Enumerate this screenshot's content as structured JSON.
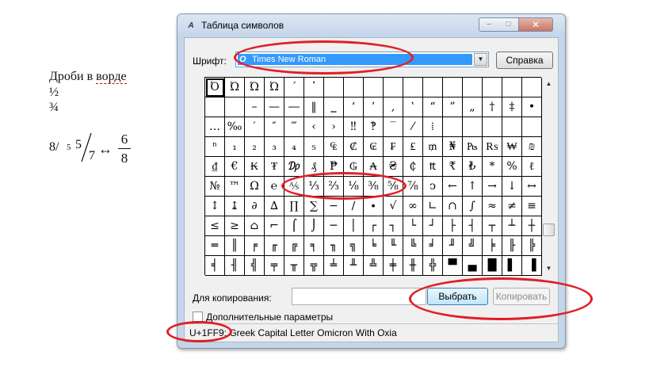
{
  "document": {
    "title": "Дроби в ворде",
    "title_part1": "Дроби в ",
    "title_part2": "ворде",
    "line_half": "½",
    "line_three_quarters": "¾",
    "formula": {
      "slash_fraction": "8/5",
      "slash_num": "8/",
      "slash_den": "5",
      "diagonal_num": "5",
      "diagonal_den": "7",
      "arrow": "↔",
      "stacked_num": "6",
      "stacked_den": "8"
    }
  },
  "dialog": {
    "title": "Таблица символов",
    "app_icon_glyph": "A",
    "min_glyph": "–",
    "max_glyph": "□",
    "close_glyph": "✕",
    "font_label": "Шрифт:",
    "font_value": "Times New Roman",
    "font_icon_glyph": "O",
    "font_dropdown_glyph": "▼",
    "help_label": "Справка",
    "copy_label": "Для копирования:",
    "copy_value": "",
    "select_label": "Выбрать",
    "copy_button_label": "Копировать",
    "advanced_label": "Дополнительные параметры",
    "advanced_checked": false,
    "status_text": "U+1FF9: Greek Capital Letter Omicron With Oxia",
    "scroll_up_glyph": "▲",
    "scroll_down_glyph": "▼"
  },
  "grid": {
    "selected_index": 0,
    "cells": [
      "Ό",
      "Ώ",
      "Ώ",
      "Ώ",
      "´",
      "῾",
      "",
      "",
      "",
      "",
      "",
      "",
      "",
      "",
      "",
      "",
      "",
      "",
      "",
      "–",
      "—",
      "―",
      "‖",
      "‗",
      "‘",
      "’",
      "‚",
      "‛",
      "“",
      "”",
      "„",
      "†",
      "‡",
      "•",
      "…",
      "‰",
      "′",
      "″",
      "‴",
      "‹",
      "›",
      "‼",
      "‽",
      "‾",
      "⁄",
      "⁞",
      "",
      "",
      "",
      "",
      "",
      "ⁿ",
      "₁",
      "₂",
      "₃",
      "₄",
      "₅",
      "₠",
      "₡",
      "₢",
      "₣",
      "₤",
      "₥",
      "₦",
      "₧",
      "₨",
      "₩",
      "₪",
      "₫",
      "€",
      "₭",
      "₮",
      "₯",
      "₰",
      "₱",
      "₲",
      "₳",
      "₴",
      "₵",
      "₶",
      "₹",
      "₺",
      "*",
      "%",
      "ℓ",
      "№",
      "™",
      "Ω",
      "℮",
      "⅍",
      "⅓",
      "⅔",
      "⅛",
      "⅜",
      "⅝",
      "⅞",
      "ↄ",
      "←",
      "↑",
      "→",
      "↓",
      "↔",
      "↕",
      "↨",
      "∂",
      "∆",
      "∏",
      "∑",
      "−",
      "∕",
      "∙",
      "√",
      "∞",
      "∟",
      "∩",
      "∫",
      "≈",
      "≠",
      "≡",
      "≤",
      "≥",
      "⌂",
      "⌐",
      "⌠",
      "⌡",
      "─",
      "│",
      "┌",
      "┐",
      "└",
      "┘",
      "├",
      "┤",
      "┬",
      "┴",
      "┼",
      "═",
      "║",
      "╒",
      "╓",
      "╔",
      "╕",
      "╖",
      "╗",
      "╘",
      "╙",
      "╚",
      "╛",
      "╜",
      "╝",
      "╞",
      "╟",
      "╠",
      "╡",
      "╢",
      "╣",
      "╤",
      "╥",
      "╦",
      "╧",
      "╨",
      "╩",
      "╪",
      "╫",
      "╬",
      "▀",
      "▄",
      "█",
      "▌",
      "▐"
    ]
  },
  "colors": {
    "annotation_ring": "#e01f26",
    "selection_blue": "#3399ff",
    "dialog_frame": "#c6d6ea"
  }
}
